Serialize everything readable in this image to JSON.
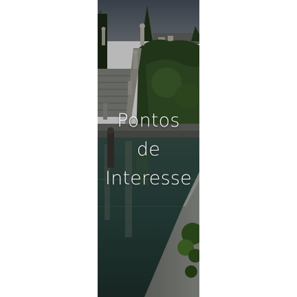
{
  "tile": {
    "caption_lines": [
      "Pontos",
      "de",
      "Interesse"
    ]
  },
  "colors": {
    "page_background": "#ffffff",
    "caption_text": "#ffffff",
    "sky": "#5a6470",
    "foliage": "#2f4a23",
    "water": "#2c4a44",
    "stone": "#8a8f88"
  }
}
